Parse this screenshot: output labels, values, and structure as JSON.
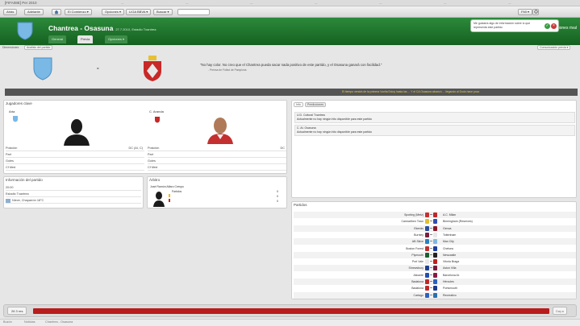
{
  "window": {
    "title": "[FIFA08E] Per 2010"
  },
  "topbar_ticks": [
    "—",
    "—",
    "—",
    "—",
    "—",
    "—",
    "—",
    "—"
  ],
  "toolbar": {
    "back": "Atrás",
    "forward": "Adelante",
    "home_icon": "home-icon",
    "menu1": "El Comienzo ▾",
    "menu2": "Opciones ▾",
    "menu3": "LIGA BBVA ▾",
    "menu4": "Buscar ▾",
    "right_menu": "FMI ▾",
    "search_value": ""
  },
  "header": {
    "title": "Chantrea - Osasuna",
    "subtitle": "27.7.2010, Estadio Txantrea",
    "instructions": "Instrucciones rival",
    "tabs": [
      "General",
      "Previa",
      "Opciones ▾"
    ],
    "active_tab": 1,
    "accent": "#1f6e2e"
  },
  "notice": {
    "text": "Me gustaría algo de información sobre lo que representa este partido"
  },
  "subbar": {
    "label": "Dimensiones",
    "pill": "Analisis del partido",
    "right_pill": "Comunicación previa ▾"
  },
  "versus": {
    "dash": "-",
    "quote": "\"No hay color. No creo que el Chantrea pueda sacar nada positivo de este partido, y el Osasuna ganará con facilidad.\"",
    "source": "- Prensa de Fútbol de Pamplona"
  },
  "ticker": "El tiempo vendrá de la primera Vuelta Estoy hasta las ... Y el CA Osasuna alcanzó ... llegando al Dodo hace poco",
  "key_players": {
    "title": "Jugadores clave",
    "home_name": "Arta",
    "away_name": "C. Aranda",
    "labels": [
      "Posición",
      "Part",
      "Goles",
      "Cf Med"
    ],
    "home_values": [
      "DC (AI, C)",
      "",
      "",
      ""
    ],
    "away_values": [
      "DC",
      "",
      "",
      ""
    ]
  },
  "match_info": {
    "title": "Información del partido",
    "rows": [
      "20:00",
      "Estadio Txantrea",
      "Nieve, Chaparrón 18°C"
    ]
  },
  "referee": {
    "title": "Árbitro",
    "name": "José Ramón Alfaro Crespo",
    "stat_label": "Partidos",
    "yellow_label": "",
    "red_label": "",
    "values": [
      "0",
      "0",
      "0"
    ]
  },
  "news": {
    "tabs": [
      "Info",
      "Predicciones"
    ],
    "home_team": "U.D. Cultural Txantrea",
    "home_text": "Actualmente no hay ningún hito disponible para este partido",
    "away_team": "C. At. Osasuna",
    "away_text": "Actualmente no hay ningún hito disponible para este partido"
  },
  "matches": {
    "title": "Partidos",
    "rows": [
      {
        "home": "Sporting (Metz)",
        "away": "A.C. Milan",
        "hc": "#c83030",
        "ac": "#c02828"
      },
      {
        "home": "Carmarthen Town",
        "away": "Birmingham (Reserves)",
        "hc": "#e0c030",
        "ac": "#3050b0"
      },
      {
        "home": "Ekenäs",
        "away": "Genoa",
        "hc": "#2a50a0",
        "ac": "#8a1a2a"
      },
      {
        "home": "Burnley",
        "away": "Tottenham",
        "hc": "#7a2040",
        "ac": "#e8e8e8"
      },
      {
        "home": "AB Skive",
        "away": "Man City",
        "hc": "#2a80c0",
        "ac": "#80b8e0"
      },
      {
        "home": "Boston Forest",
        "away": "Chelsea",
        "hc": "#c03030",
        "ac": "#1a40a0"
      },
      {
        "home": "Plymouth",
        "away": "Newcastle",
        "hc": "#1a6030",
        "ac": "#222222"
      },
      {
        "home": "Port Vale",
        "away": "Vitoria Braga",
        "hc": "#e8e8e8",
        "ac": "#c02020"
      },
      {
        "home": "Shrewsbury",
        "away": "Aston Villa",
        "hc": "#1a4090",
        "ac": "#7a1a3a"
      },
      {
        "home": "Alicante",
        "away": "Barcelona At.",
        "hc": "#2050b0",
        "ac": "#8a1a40"
      },
      {
        "home": "Badalona",
        "away": "Hércules",
        "hc": "#c02828",
        "ac": "#2a60c0"
      },
      {
        "home": "Badalona",
        "away": "Portsmouth",
        "hc": "#c02828",
        "ac": "#1a3a90"
      },
      {
        "home": "Cartago",
        "away": "Recreativo",
        "hc": "#3060c0",
        "ac": "#2a70b0"
      }
    ]
  },
  "bottom": {
    "left": "26 3 res",
    "right": "Day ▸",
    "progress": 1.0,
    "bar_color": "#b81c1c"
  },
  "status": [
    "Buzón",
    "Noticias",
    "Chantrea - Osasuna"
  ]
}
